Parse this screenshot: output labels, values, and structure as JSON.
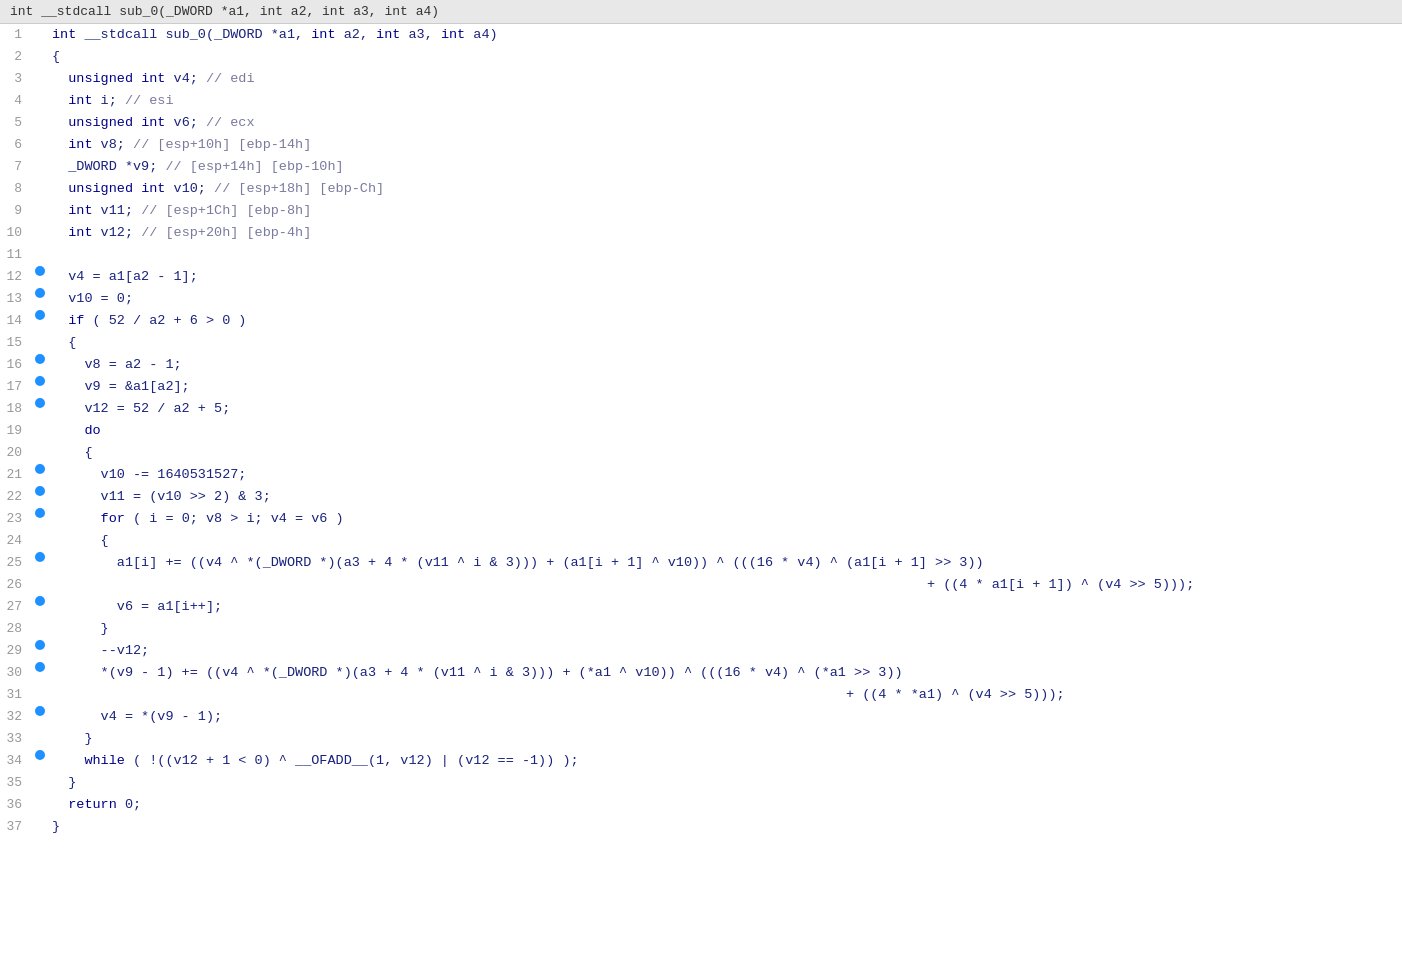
{
  "header": {
    "title": "int __stdcall sub_0(_DWORD *a1, int a2, int a3, int a4)"
  },
  "lines": [
    {
      "num": 1,
      "bp": false,
      "html": "<span class='kw'>int</span> __stdcall sub_0(_DWORD *a1, <span class='kw'>int</span> a2, <span class='kw'>int</span> a3, <span class='kw'>int</span> a4)"
    },
    {
      "num": 2,
      "bp": false,
      "html": "{"
    },
    {
      "num": 3,
      "bp": false,
      "html": "  <span class='kw'>unsigned</span> <span class='kw'>int</span> v4; <span class='cm'>// edi</span>"
    },
    {
      "num": 4,
      "bp": false,
      "html": "  <span class='kw'>int</span> i; <span class='cm'>// esi</span>"
    },
    {
      "num": 5,
      "bp": false,
      "html": "  <span class='kw'>unsigned</span> <span class='kw'>int</span> v6; <span class='cm'>// ecx</span>"
    },
    {
      "num": 6,
      "bp": false,
      "html": "  <span class='kw'>int</span> v8; <span class='cm'>// [esp+10h] [ebp-14h]</span>"
    },
    {
      "num": 7,
      "bp": false,
      "html": "  _DWORD *v9; <span class='cm'>// [esp+14h] [ebp-10h]</span>"
    },
    {
      "num": 8,
      "bp": false,
      "html": "  <span class='kw'>unsigned</span> <span class='kw'>int</span> v10; <span class='cm'>// [esp+18h] [ebp-Ch]</span>"
    },
    {
      "num": 9,
      "bp": false,
      "html": "  <span class='kw'>int</span> v11; <span class='cm'>// [esp+1Ch] [ebp-8h]</span>"
    },
    {
      "num": 10,
      "bp": false,
      "html": "  <span class='kw'>int</span> v12; <span class='cm'>// [esp+20h] [ebp-4h]</span>"
    },
    {
      "num": 11,
      "bp": false,
      "html": ""
    },
    {
      "num": 12,
      "bp": true,
      "html": "  v4 = a1[a2 - 1];"
    },
    {
      "num": 13,
      "bp": true,
      "html": "  v10 = 0;"
    },
    {
      "num": 14,
      "bp": true,
      "html": "  <span class='kw'>if</span> ( 52 / a2 + 6 &gt; 0 )"
    },
    {
      "num": 15,
      "bp": false,
      "html": "  {"
    },
    {
      "num": 16,
      "bp": true,
      "html": "    v8 = a2 - 1;"
    },
    {
      "num": 17,
      "bp": true,
      "html": "    v9 = &amp;a1[a2];"
    },
    {
      "num": 18,
      "bp": true,
      "html": "    v12 = 52 / a2 + 5;"
    },
    {
      "num": 19,
      "bp": false,
      "html": "    <span class='kw'>do</span>"
    },
    {
      "num": 20,
      "bp": false,
      "html": "    {"
    },
    {
      "num": 21,
      "bp": true,
      "html": "      v10 -= 1640531527;"
    },
    {
      "num": 22,
      "bp": true,
      "html": "      v11 = (v10 &gt;&gt; 2) &amp; 3;"
    },
    {
      "num": 23,
      "bp": true,
      "html": "      <span class='kw'>for</span> ( i = 0; v8 &gt; i; v4 = v6 )"
    },
    {
      "num": 24,
      "bp": false,
      "html": "      {"
    },
    {
      "num": 25,
      "bp": true,
      "html": "        a1[i] += ((v4 ^ *(_DWORD *)(a3 + 4 * (v11 ^ i &amp; 3))) + (a1[i + 1] ^ v10)) ^ (((16 * v4) ^ (a1[i + 1] &gt;&gt; 3))"
    },
    {
      "num": 26,
      "bp": false,
      "html": "                                                                                                            + ((4 * a1[i + 1]) ^ (v4 &gt;&gt; 5)));"
    },
    {
      "num": 27,
      "bp": true,
      "html": "        v6 = a1[i++];"
    },
    {
      "num": 28,
      "bp": false,
      "html": "      }"
    },
    {
      "num": 29,
      "bp": true,
      "html": "      --v12;"
    },
    {
      "num": 30,
      "bp": true,
      "html": "      *(v9 - 1) += ((v4 ^ *(_DWORD *)(a3 + 4 * (v11 ^ i &amp; 3))) + (*a1 ^ v10)) ^ (((16 * v4) ^ (*a1 &gt;&gt; 3))"
    },
    {
      "num": 31,
      "bp": false,
      "html": "                                                                                                  + ((4 * *a1) ^ (v4 &gt;&gt; 5)));"
    },
    {
      "num": 32,
      "bp": true,
      "html": "      v4 = *(v9 - 1);"
    },
    {
      "num": 33,
      "bp": false,
      "html": "    }"
    },
    {
      "num": 34,
      "bp": true,
      "html": "    <span class='kw'>while</span> ( !((v12 + 1 &lt; 0) ^ __OFADD__(1, v12) | (v12 == -1)) );"
    },
    {
      "num": 35,
      "bp": false,
      "html": "  }"
    },
    {
      "num": 36,
      "bp": false,
      "html": "  <span class='kw'>return</span> 0;"
    },
    {
      "num": 37,
      "bp": false,
      "html": "}"
    }
  ]
}
